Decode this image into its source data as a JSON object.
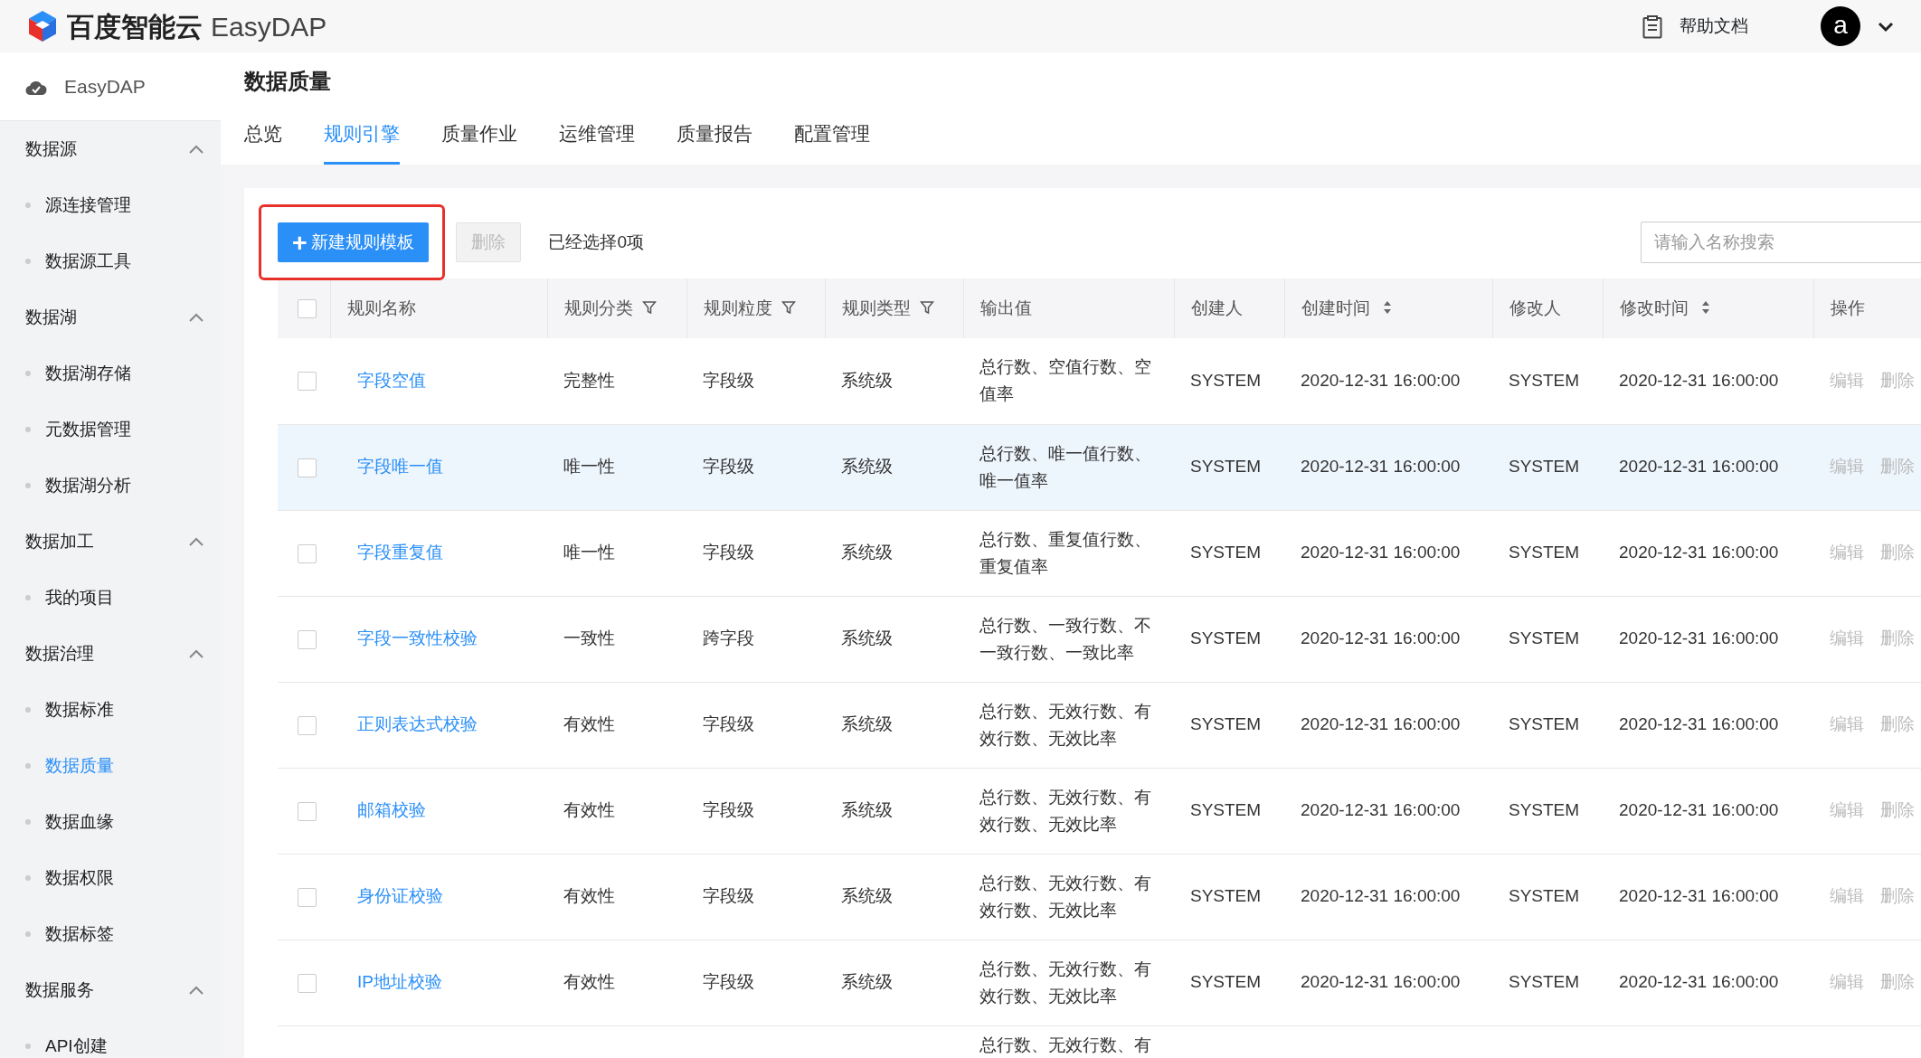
{
  "topbar": {
    "brand": "百度智能云",
    "product": "EasyDAP",
    "help": "帮助文档",
    "avatar": "a"
  },
  "sidebar": {
    "title": "EasyDAP",
    "groups": [
      {
        "label": "数据源",
        "expanded": true,
        "items": [
          {
            "label": "源连接管理",
            "selected": false
          },
          {
            "label": "数据源工具",
            "selected": false
          }
        ]
      },
      {
        "label": "数据湖",
        "expanded": true,
        "items": [
          {
            "label": "数据湖存储",
            "selected": false
          },
          {
            "label": "元数据管理",
            "selected": false
          },
          {
            "label": "数据湖分析",
            "selected": false
          }
        ]
      },
      {
        "label": "数据加工",
        "expanded": true,
        "items": [
          {
            "label": "我的项目",
            "selected": false
          }
        ]
      },
      {
        "label": "数据治理",
        "expanded": true,
        "items": [
          {
            "label": "数据标准",
            "selected": false
          },
          {
            "label": "数据质量",
            "selected": true
          },
          {
            "label": "数据血缘",
            "selected": false
          },
          {
            "label": "数据权限",
            "selected": false
          },
          {
            "label": "数据标签",
            "selected": false
          }
        ]
      },
      {
        "label": "数据服务",
        "expanded": true,
        "items": [
          {
            "label": "API创建",
            "selected": false
          }
        ]
      }
    ]
  },
  "page": {
    "title": "数据质量",
    "tabs": [
      {
        "label": "总览",
        "selected": false
      },
      {
        "label": "规则引擎",
        "selected": true
      },
      {
        "label": "质量作业",
        "selected": false
      },
      {
        "label": "运维管理",
        "selected": false
      },
      {
        "label": "质量报告",
        "selected": false
      },
      {
        "label": "配置管理",
        "selected": false
      }
    ]
  },
  "toolbar": {
    "new_button": {
      "icon": "+",
      "label": "新建规则模板",
      "annotated": true
    },
    "delete_button": {
      "label": "删除",
      "disabled": true
    },
    "selection_text": "已经选择0项",
    "search": {
      "placeholder": "请输入名称搜索"
    }
  },
  "table": {
    "select_all_checked": false,
    "columns": [
      {
        "label": "规则名称",
        "kind": "plain"
      },
      {
        "label": "规则分类",
        "kind": "filter"
      },
      {
        "label": "规则粒度",
        "kind": "filter"
      },
      {
        "label": "规则类型",
        "kind": "filter"
      },
      {
        "label": "输出值",
        "kind": "plain"
      },
      {
        "label": "创建人",
        "kind": "plain"
      },
      {
        "label": "创建时间",
        "kind": "sort"
      },
      {
        "label": "修改人",
        "kind": "plain"
      },
      {
        "label": "修改时间",
        "kind": "sort"
      },
      {
        "label": "操作",
        "kind": "plain"
      }
    ],
    "rows": [
      {
        "checked": false,
        "highlighted": false,
        "name": "字段空值",
        "category": "完整性",
        "granularity": "字段级",
        "type": "系统级",
        "output": "总行数、空值行数、空值率",
        "creator": "SYSTEM",
        "created": "2020-12-31 16:00:00",
        "modifier": "SYSTEM",
        "modified": "2020-12-31 16:00:00",
        "actions": [
          "编辑",
          "删除"
        ]
      },
      {
        "checked": false,
        "highlighted": true,
        "name": "字段唯一值",
        "category": "唯一性",
        "granularity": "字段级",
        "type": "系统级",
        "output": "总行数、唯一值行数、唯一值率",
        "creator": "SYSTEM",
        "created": "2020-12-31 16:00:00",
        "modifier": "SYSTEM",
        "modified": "2020-12-31 16:00:00",
        "actions": [
          "编辑",
          "删除"
        ]
      },
      {
        "checked": false,
        "highlighted": false,
        "name": "字段重复值",
        "category": "唯一性",
        "granularity": "字段级",
        "type": "系统级",
        "output": "总行数、重复值行数、重复值率",
        "creator": "SYSTEM",
        "created": "2020-12-31 16:00:00",
        "modifier": "SYSTEM",
        "modified": "2020-12-31 16:00:00",
        "actions": [
          "编辑",
          "删除"
        ]
      },
      {
        "checked": false,
        "highlighted": false,
        "name": "字段一致性校验",
        "category": "一致性",
        "granularity": "跨字段",
        "type": "系统级",
        "output": "总行数、一致行数、不一致行数、一致比率",
        "creator": "SYSTEM",
        "created": "2020-12-31 16:00:00",
        "modifier": "SYSTEM",
        "modified": "2020-12-31 16:00:00",
        "actions": [
          "编辑",
          "删除"
        ]
      },
      {
        "checked": false,
        "highlighted": false,
        "name": "正则表达式校验",
        "category": "有效性",
        "granularity": "字段级",
        "type": "系统级",
        "output": "总行数、无效行数、有效行数、无效比率",
        "creator": "SYSTEM",
        "created": "2020-12-31 16:00:00",
        "modifier": "SYSTEM",
        "modified": "2020-12-31 16:00:00",
        "actions": [
          "编辑",
          "删除"
        ]
      },
      {
        "checked": false,
        "highlighted": false,
        "name": "邮箱校验",
        "category": "有效性",
        "granularity": "字段级",
        "type": "系统级",
        "output": "总行数、无效行数、有效行数、无效比率",
        "creator": "SYSTEM",
        "created": "2020-12-31 16:00:00",
        "modifier": "SYSTEM",
        "modified": "2020-12-31 16:00:00",
        "actions": [
          "编辑",
          "删除"
        ]
      },
      {
        "checked": false,
        "highlighted": false,
        "name": "身份证校验",
        "category": "有效性",
        "granularity": "字段级",
        "type": "系统级",
        "output": "总行数、无效行数、有效行数、无效比率",
        "creator": "SYSTEM",
        "created": "2020-12-31 16:00:00",
        "modifier": "SYSTEM",
        "modified": "2020-12-31 16:00:00",
        "actions": [
          "编辑",
          "删除"
        ]
      },
      {
        "checked": false,
        "highlighted": false,
        "name": "IP地址校验",
        "category": "有效性",
        "granularity": "字段级",
        "type": "系统级",
        "output": "总行数、无效行数、有效行数、无效比率",
        "creator": "SYSTEM",
        "created": "2020-12-31 16:00:00",
        "modifier": "SYSTEM",
        "modified": "2020-12-31 16:00:00",
        "actions": [
          "编辑",
          "删除"
        ]
      },
      {
        "output": "总行数、无效行数、有"
      }
    ]
  }
}
